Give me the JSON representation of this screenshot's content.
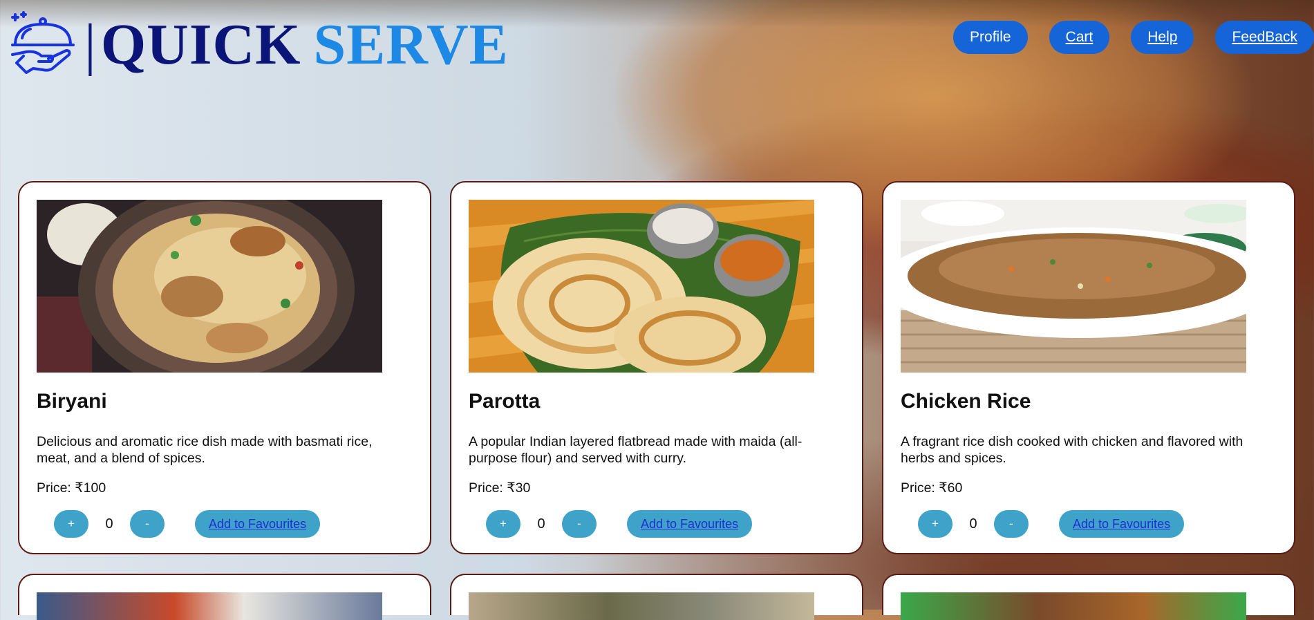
{
  "brand": {
    "word1": "QUICK",
    "word2": "SERVE",
    "icon": "cloche-hand-icon"
  },
  "nav": [
    {
      "label": "Profile",
      "name": "nav-profile-button"
    },
    {
      "label": "Cart",
      "name": "nav-cart-link"
    },
    {
      "label": "Help",
      "name": "nav-help-link"
    },
    {
      "label": "FeedBack",
      "name": "nav-feedback-link"
    }
  ],
  "items": [
    {
      "name": "Biryani",
      "description": "Delicious and aromatic rice dish made with basmati rice, meat, and a blend of spices.",
      "price": "Price: ₹100",
      "qty": "0",
      "plus": "+",
      "minus": "-",
      "fav": "Add to Favourites"
    },
    {
      "name": "Parotta",
      "description": "A popular Indian layered flatbread made with maida (all-purpose flour) and served with curry.",
      "price": "Price: ₹30",
      "qty": "0",
      "plus": "+",
      "minus": "-",
      "fav": "Add to Favourites"
    },
    {
      "name": "Chicken Rice",
      "description": "A fragrant rice dish cooked with chicken and flavored with herbs and spices.",
      "price": "Price: ₹60",
      "qty": "0",
      "plus": "+",
      "minus": "-",
      "fav": "Add to Favourites"
    }
  ],
  "colors": {
    "nav_button": "#1565d8",
    "action_button": "#3fa2c9",
    "card_border": "#5a1b14",
    "brand_dark": "#0b1577",
    "brand_light": "#1e88e5"
  }
}
